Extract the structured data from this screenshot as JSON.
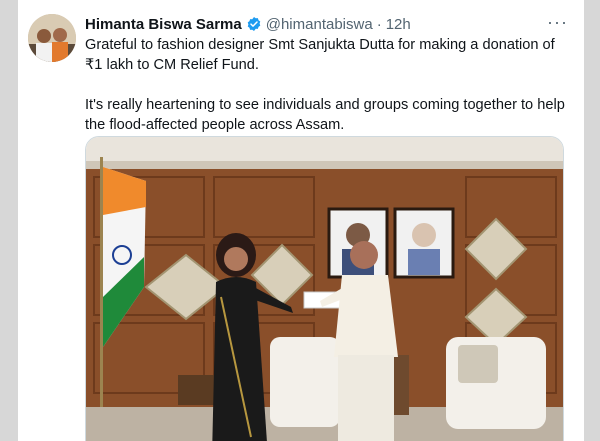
{
  "tweet": {
    "author_name": "Himanta Biswa Sarma",
    "handle": "@himantabiswa",
    "separator": "·",
    "time": "12h",
    "more_label": "···",
    "paragraph1": "Grateful to fashion designer Smt Sanjukta Dutta for making a donation of ₹1 lakh to CM Relief Fund.",
    "paragraph2": "It's really heartening to see individuals and groups coming together to help the flood-affected people across Assam."
  },
  "colors": {
    "verified_badge": "#1d9bf0",
    "text": "#0f1419",
    "secondary_text": "#536471"
  },
  "icons": {
    "verified": "verified-badge-icon",
    "more": "more-dots-icon"
  }
}
